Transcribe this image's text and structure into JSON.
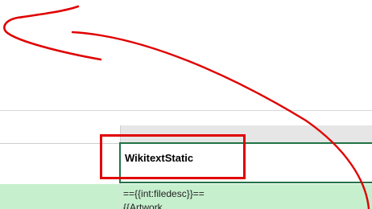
{
  "sheet": {
    "active_cell_value": "WikitextStatic",
    "next_row_line1": "=={{int:filedesc}}==",
    "next_row_line2": "{{Artwork"
  },
  "annotation": {
    "highlight_color": "#e00000",
    "arrow_color": "#e00000"
  },
  "colors": {
    "excel_green": "#217346",
    "row_fill_green": "#c6efce",
    "header_gray": "#e6e6e6"
  }
}
